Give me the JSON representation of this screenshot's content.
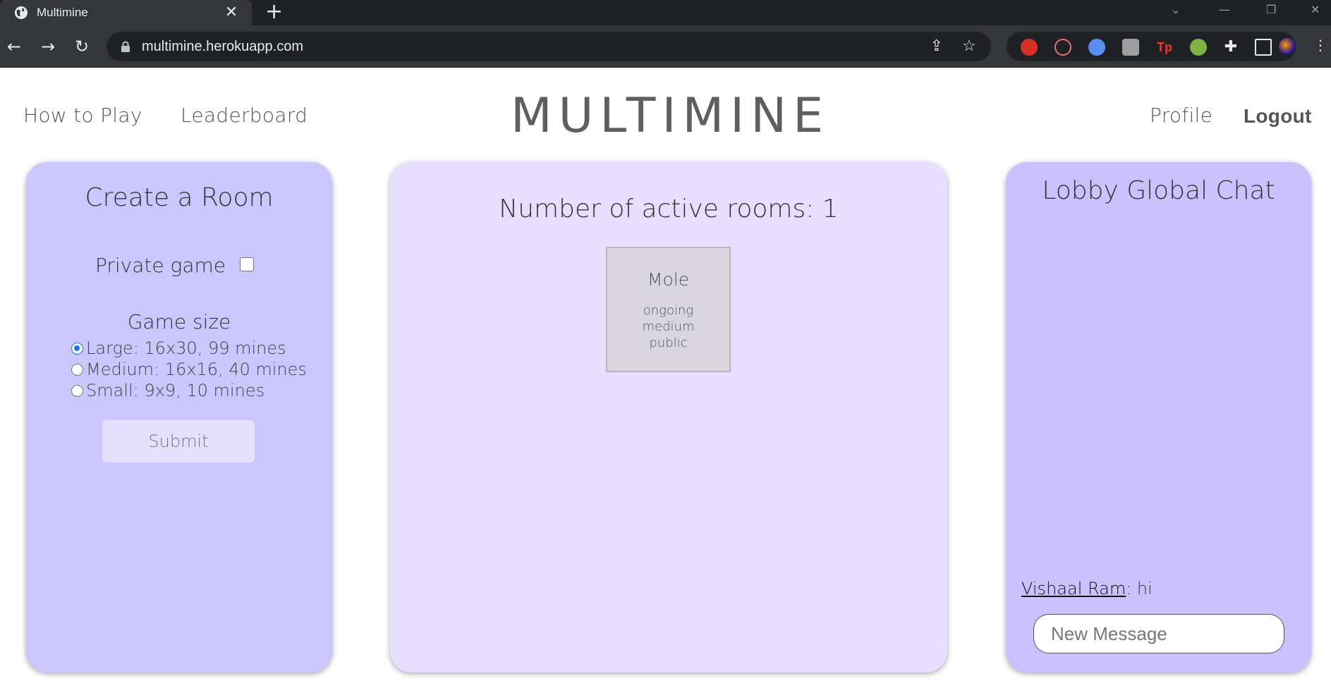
{
  "browser": {
    "tab_title": "Multimine",
    "url": "multimine.herokuapp.com",
    "new_tab_glyph": "+",
    "tab_close_glyph": "✕"
  },
  "nav": {
    "how_to_play": "How to Play",
    "leaderboard": "Leaderboard",
    "logo": "MULTIMINE",
    "profile": "Profile",
    "logout": "Logout"
  },
  "create_room": {
    "title": "Create a Room",
    "private_label": "Private game",
    "private_checked": false,
    "size_title": "Game size",
    "options": [
      {
        "label": "Large: 16x30, 99 mines",
        "selected": true
      },
      {
        "label": "Medium: 16x16, 40 mines",
        "selected": false
      },
      {
        "label": "Small: 9x9, 10 mines",
        "selected": false
      }
    ],
    "submit": "Submit"
  },
  "rooms": {
    "title": "Number of active rooms: 1",
    "list": [
      {
        "name": "Mole",
        "status": "ongoing",
        "size": "medium",
        "visibility": "public"
      }
    ]
  },
  "chat": {
    "title": "Lobby Global Chat",
    "messages": [
      {
        "user": "Vishaal Ram",
        "text": ": hi"
      }
    ],
    "input_placeholder": "New Message"
  },
  "colors": {
    "left_panel": "#ccc6ff",
    "mid_panel": "#e8deff",
    "right_panel": "#cbc1ff",
    "room_card": "#d9d6df",
    "radio_accent": "#1a73e8"
  }
}
